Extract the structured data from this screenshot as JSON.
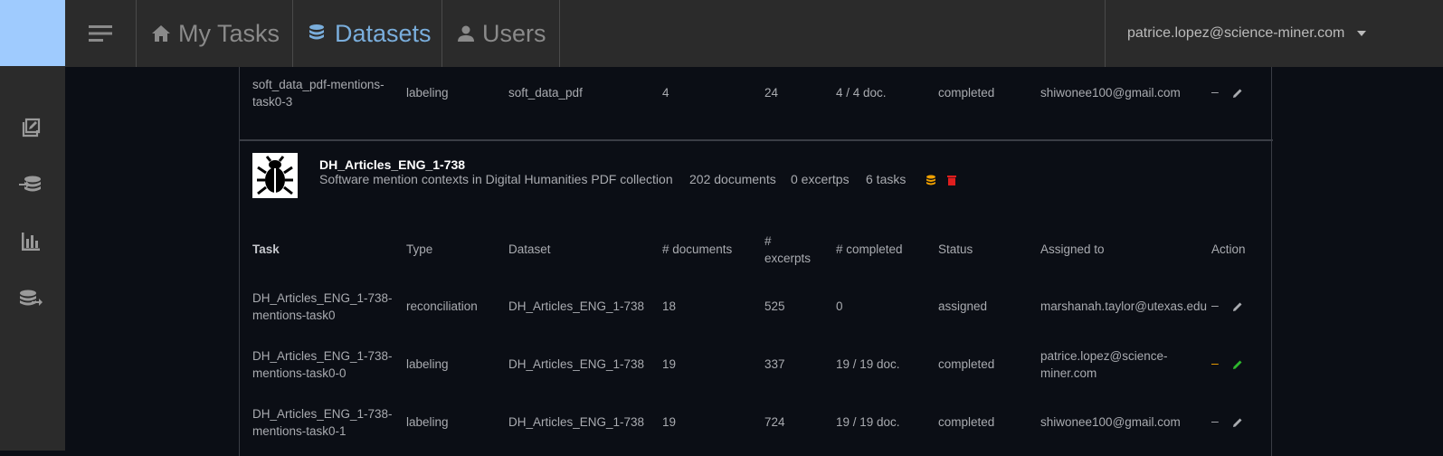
{
  "nav": {
    "tabs": [
      {
        "label": "My Tasks",
        "icon": "home-icon"
      },
      {
        "label": "Datasets",
        "icon": "database-icon"
      },
      {
        "label": "Users",
        "icon": "person-icon"
      }
    ],
    "active_tab": "Datasets",
    "user_email": "patrice.lopez@science-miner.com"
  },
  "sidebar": {
    "icons": [
      "edit-note-icon",
      "dataset-import-icon",
      "bar-chart-icon",
      "dataset-export-icon"
    ]
  },
  "prev_task": {
    "task": [
      "soft_data_pdf-mentions-",
      "task0-3"
    ],
    "type": "labeling",
    "dataset": "soft_data_pdf",
    "documents": "4",
    "excerpts": "24",
    "completed": "4 / 4 doc.",
    "status": "completed",
    "assigned": "shiwonee100@gmail.com",
    "action_dash": "–"
  },
  "dataset": {
    "title": "DH_Articles_ENG_1-738",
    "description": "Software mention contexts in Digital Humanities PDF collection",
    "documents": "202 documents",
    "excerpts": "0 excertps",
    "tasks": "6 tasks"
  },
  "table": {
    "headers": {
      "task": "Task",
      "type": "Type",
      "dataset": "Dataset",
      "documents": "# documents",
      "excerpts_1": "#",
      "excerpts_2": "excerpts",
      "completed": "# completed",
      "status": "Status",
      "assigned": "Assigned to",
      "action": "Action"
    },
    "rows": [
      {
        "task": [
          "DH_Articles_ENG_1-738-",
          "mentions-task0"
        ],
        "type": "reconciliation",
        "dataset": "DH_Articles_ENG_1-738",
        "documents": "18",
        "excerpts": "525",
        "completed": "0",
        "status": "assigned",
        "assigned": [
          "marshanah.taylor@utexas.edu",
          ""
        ],
        "action_dash": "–"
      },
      {
        "task": [
          "DH_Articles_ENG_1-738-",
          "mentions-task0-0"
        ],
        "type": "labeling",
        "dataset": "DH_Articles_ENG_1-738",
        "documents": "19",
        "excerpts": "337",
        "completed": "19 / 19 doc.",
        "status": "completed",
        "assigned": [
          "patrice.lopez@science-",
          "miner.com"
        ],
        "action_dash": "–"
      },
      {
        "task": [
          "DH_Articles_ENG_1-738-",
          "mentions-task0-1"
        ],
        "type": "labeling",
        "dataset": "DH_Articles_ENG_1-738",
        "documents": "19",
        "excerpts": "724",
        "completed": "19 / 19 doc.",
        "status": "completed",
        "assigned": [
          "shiwonee100@gmail.com",
          ""
        ],
        "action_dash": "–"
      }
    ]
  },
  "colors": {
    "accent_blue": "#7aaedc",
    "logo_blue": "#9fcbfe",
    "orange": "#f0a000",
    "red": "#e01e1e",
    "green": "#2eb82e"
  }
}
